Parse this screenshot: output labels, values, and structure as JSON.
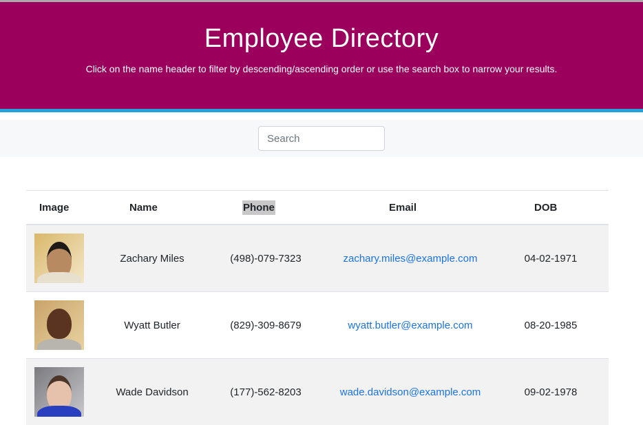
{
  "header": {
    "title": "Employee Directory",
    "subtitle": "Click on the name header to filter by descending/ascending order or use the search box to narrow your results."
  },
  "search": {
    "placeholder": "Search",
    "value": ""
  },
  "table": {
    "columns": [
      "Image",
      "Name",
      "Phone",
      "Email",
      "DOB"
    ],
    "rows": [
      {
        "name": "Zachary Miles",
        "phone": "(498)-079-7323",
        "email": "zachary.miles@example.com",
        "dob": "04-02-1971"
      },
      {
        "name": "Wyatt Butler",
        "phone": "(829)-309-8679",
        "email": "wyatt.butler@example.com",
        "dob": "08-20-1985"
      },
      {
        "name": "Wade Davidson",
        "phone": "(177)-562-8203",
        "email": "wade.davidson@example.com",
        "dob": "09-02-1978"
      }
    ]
  },
  "colors": {
    "header_bg": "#9b005c",
    "accent_bar": "#23a1d8",
    "link": "#1a73e8"
  }
}
